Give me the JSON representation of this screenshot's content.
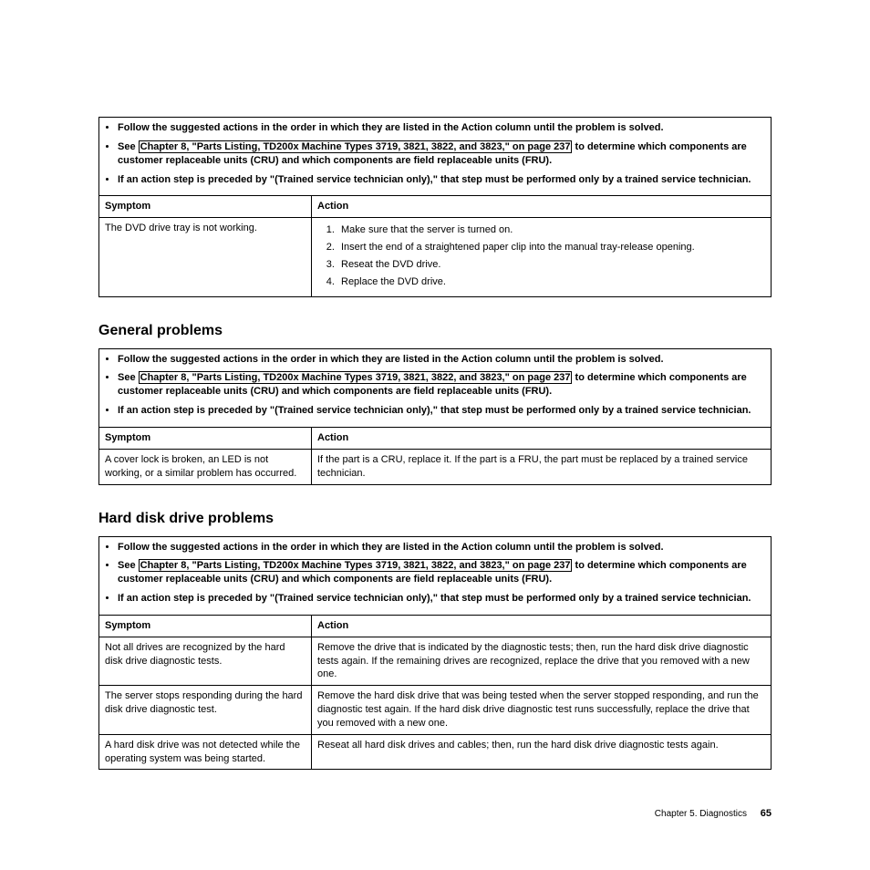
{
  "common_notes": {
    "n1": "Follow the suggested actions in the order in which they are listed in the Action column until the problem is solved.",
    "n2a": "See ",
    "n2link": "Chapter 8, \"Parts Listing, TD200x Machine Types 3719, 3821, 3822, and 3823,\" on page 237",
    "n2b": " to determine which components are customer replaceable units (CRU) and which components are field replaceable units (FRU).",
    "n3": "If an action step is preceded by \"(Trained service technician only),\" that step must be performed only by a trained service technician."
  },
  "headers": {
    "symptom": "Symptom",
    "action": "Action"
  },
  "dvd": {
    "symptom": "The DVD drive tray is not working.",
    "steps": [
      "Make sure that the server is turned on.",
      "Insert the end of a straightened paper clip into the manual tray-release opening.",
      "Reseat the DVD drive.",
      "Replace the DVD drive."
    ]
  },
  "general": {
    "heading": "General problems",
    "symptom": "A cover lock is broken, an LED is not working, or a similar problem has occurred.",
    "action": "If the part is a CRU, replace it. If the part is a FRU, the part must be replaced by a trained service technician."
  },
  "hdd": {
    "heading": "Hard disk drive problems",
    "rows": [
      {
        "symptom": "Not all drives are recognized by the hard disk drive diagnostic tests.",
        "action": "Remove the drive that is indicated by the diagnostic tests; then, run the hard disk drive diagnostic tests again. If the remaining drives are recognized, replace the drive that you removed with a new one."
      },
      {
        "symptom": "The server stops responding during the hard disk drive diagnostic test.",
        "action": "Remove the hard disk drive that was being tested when the server stopped responding, and run the diagnostic test again. If the hard disk drive diagnostic test runs successfully, replace the drive that you removed with a new one."
      },
      {
        "symptom": "A hard disk drive was not detected while the operating system was being started.",
        "action": "Reseat all hard disk drives and cables; then, run the hard disk drive diagnostic tests again."
      }
    ]
  },
  "footer": {
    "chapter": "Chapter 5. Diagnostics",
    "page": "65"
  }
}
